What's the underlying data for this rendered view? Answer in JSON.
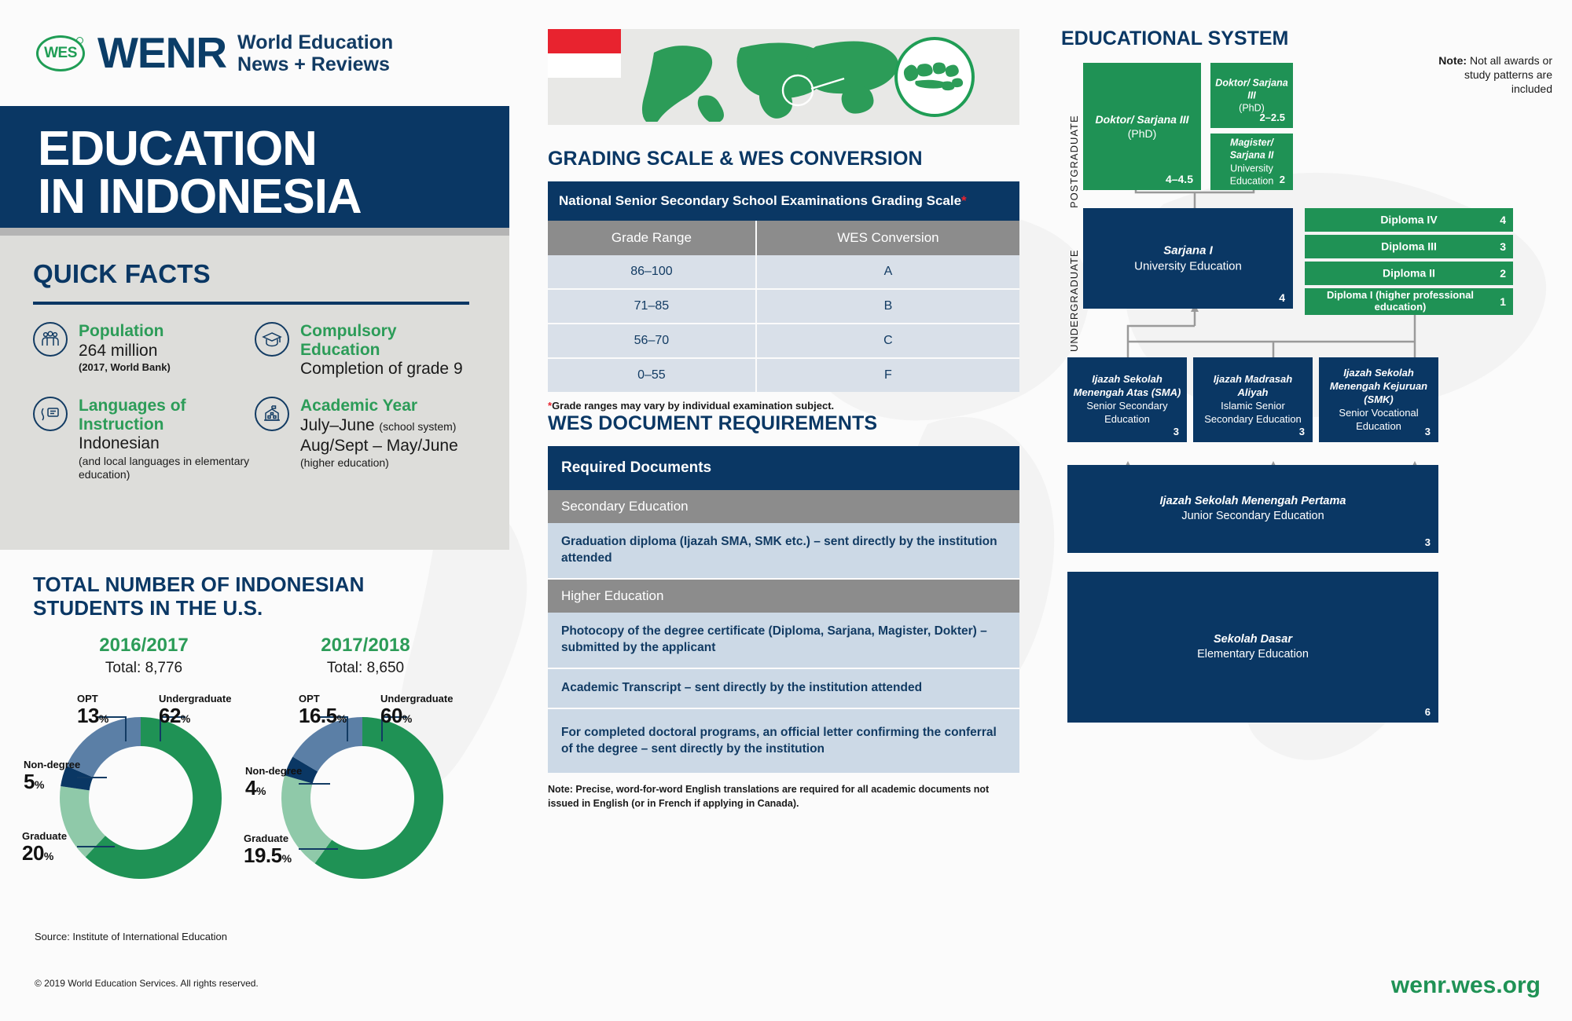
{
  "brand": {
    "wes_mark": "WES",
    "wenr": "WENR",
    "tagline_line1": "World Education",
    "tagline_line2": "News + Reviews",
    "url": "wenr.wes.org",
    "copyright": "© 2019 World Education Services. All rights reserved."
  },
  "title": {
    "line1": "EDUCATION",
    "line2": "IN INDONESIA"
  },
  "quick_facts": {
    "heading": "QUICK FACTS",
    "items": [
      {
        "icon": "population-icon",
        "title": "Population",
        "value": "264 million",
        "note": "(2017, World Bank)"
      },
      {
        "icon": "graduation-cap-icon",
        "title": "Compulsory Education",
        "value": "Completion of grade 9",
        "note": ""
      },
      {
        "icon": "speech-icon",
        "title": "Languages of Instruction",
        "value": "Indonesian",
        "note": "(and local languages in elementary education)"
      },
      {
        "icon": "school-building-icon",
        "title": "Academic Year",
        "value": "July–June",
        "value_small": "(school system)",
        "value2": "Aug/Sept – May/June",
        "note": "(higher education)"
      }
    ]
  },
  "students_chart": {
    "heading_line1": "TOTAL NUMBER OF INDONESIAN",
    "heading_line2": "STUDENTS IN THE U.S.",
    "source": "Source: Institute of International Education"
  },
  "chart_data": [
    {
      "type": "pie",
      "title": "2016/2017",
      "subtitle": "Total: 8,776",
      "categories": [
        "Undergraduate",
        "Graduate",
        "Non-degree",
        "OPT"
      ],
      "values": [
        62,
        20,
        5,
        13
      ],
      "value_labels": [
        "62%",
        "20%",
        "5%",
        "13%"
      ],
      "colors": [
        "#1f9255",
        "#8fc9a9",
        "#0a3764",
        "#5b7fa6"
      ],
      "unit": "%",
      "legend": "labels-outside",
      "donut": true
    },
    {
      "type": "pie",
      "title": "2017/2018",
      "subtitle": "Total: 8,650",
      "categories": [
        "Undergraduate",
        "Graduate",
        "Non-degree",
        "OPT"
      ],
      "values": [
        60,
        19.5,
        4,
        16.5
      ],
      "value_labels": [
        "60%",
        "19.5%",
        "4%",
        "16.5%"
      ],
      "colors": [
        "#1f9255",
        "#8fc9a9",
        "#0a3764",
        "#5b7fa6"
      ],
      "unit": "%",
      "legend": "labels-outside",
      "donut": true
    }
  ],
  "grading": {
    "heading": "GRADING SCALE & WES CONVERSION",
    "table_title": "National Senior Secondary School Examinations Grading Scale",
    "table_title_asterisk": "*",
    "columns": [
      "Grade Range",
      "WES Conversion"
    ],
    "rows": [
      [
        "86–100",
        "A"
      ],
      [
        "71–85",
        "B"
      ],
      [
        "56–70",
        "C"
      ],
      [
        "0–55",
        "F"
      ]
    ],
    "footnote_ast": "*",
    "footnote": "Grade ranges may vary by individual examination subject."
  },
  "documents": {
    "heading": "WES DOCUMENT REQUIREMENTS",
    "table_header": "Required Documents",
    "groups": [
      {
        "label": "Secondary Education",
        "items": [
          "Graduation diploma (Ijazah SMA, SMK etc.) – sent directly by the institution attended"
        ]
      },
      {
        "label": "Higher Education",
        "items": [
          "Photocopy of the degree certificate (Diploma, Sarjana, Magister, Dokter) – submitted by the applicant",
          "Academic Transcript – sent directly by the institution attended",
          "For completed doctoral programs, an official letter confirming the conferral of the degree – sent directly by the institution"
        ]
      }
    ],
    "note": "Note: Precise, word-for-word English translations are required for all academic documents not issued in English (or in French if applying in Canada)."
  },
  "system": {
    "heading": "EDUCATIONAL SYSTEM",
    "note_label": "Note:",
    "note_text": " Not all awards or study patterns are included",
    "level_postgraduate": "POSTGRADUATE",
    "level_undergraduate": "UNDERGRADUATE",
    "boxes": [
      {
        "id": "doktor-left",
        "name": "Doktor/ Sarjana III",
        "sub": "(PhD)",
        "years": "4–4.5",
        "color": "green"
      },
      {
        "id": "doktor-right",
        "name": "Doktor/ Sarjana III",
        "sub": "(PhD)",
        "years": "2–2.5",
        "color": "green"
      },
      {
        "id": "magister",
        "name": "Magister/ Sarjana II",
        "sub": "University Education",
        "years": "2",
        "color": "green"
      },
      {
        "id": "sarjana-i",
        "name": "Sarjana I",
        "sub": "University Education",
        "years": "4",
        "color": "navy"
      },
      {
        "id": "sma",
        "name": "Ijazah Sekolah Menengah Atas (SMA)",
        "sub": "Senior Secondary Education",
        "years": "3",
        "color": "navy"
      },
      {
        "id": "madrasah",
        "name": "Ijazah Madrasah Aliyah",
        "sub": "Islamic Senior Secondary Education",
        "years": "3",
        "color": "navy"
      },
      {
        "id": "smk",
        "name": "Ijazah Sekolah Menengah Kejuruan (SMK)",
        "sub": "Senior Vocational Education",
        "years": "3",
        "color": "navy"
      },
      {
        "id": "smp",
        "name": "Ijazah Sekolah Menengah Pertama",
        "sub": "Junior Secondary Education",
        "years": "3",
        "color": "navy"
      },
      {
        "id": "sd",
        "name": "Sekolah Dasar",
        "sub": "Elementary Education",
        "years": "6",
        "color": "navy"
      }
    ],
    "diplomas": [
      {
        "label": "Diploma IV",
        "years": "4"
      },
      {
        "label": "Diploma III",
        "years": "3"
      },
      {
        "label": "Diploma II",
        "years": "2"
      },
      {
        "label": "Diploma I (higher professional education)",
        "years": "1"
      }
    ]
  },
  "colors": {
    "navy": "#0a3764",
    "green": "#1f9255",
    "grey": "#8c8c8c",
    "light_blue_row": "#d9e0e9",
    "doc_row": "#ccd9e6",
    "red": "#e8232f"
  }
}
